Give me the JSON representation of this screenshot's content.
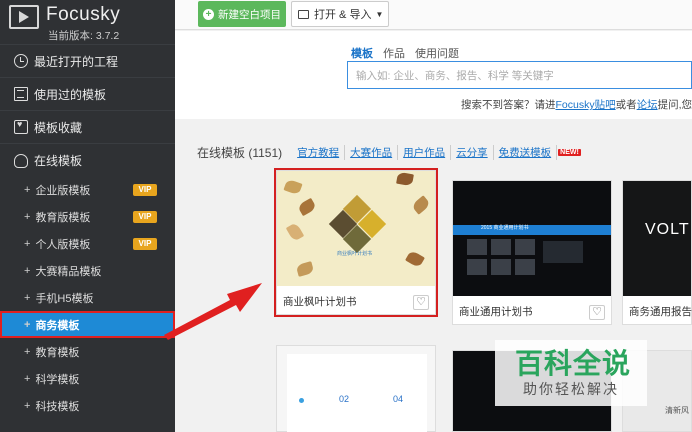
{
  "app": {
    "name": "Focusky",
    "version": "当前版本: 3.7.2"
  },
  "sidebar": {
    "sections": [
      {
        "label": "最近打开的工程",
        "icon": "clock-icon"
      },
      {
        "label": "使用过的模板",
        "icon": "list-icon"
      },
      {
        "label": "模板收藏",
        "icon": "heart-folder-icon"
      },
      {
        "label": "在线模板",
        "icon": "cloud-icon"
      }
    ],
    "items": [
      {
        "label": "企业版模板",
        "badge": "VIP"
      },
      {
        "label": "教育版模板",
        "badge": "VIP"
      },
      {
        "label": "个人版模板",
        "badge": "VIP"
      },
      {
        "label": "大赛精品模板"
      },
      {
        "label": "手机H5模板"
      },
      {
        "label": "商务模板",
        "active": true
      },
      {
        "label": "教育模板"
      },
      {
        "label": "科学模板"
      },
      {
        "label": "科技模板"
      }
    ]
  },
  "toolbar": {
    "new_label": "新建空白项目",
    "open_label": "打开 & 导入"
  },
  "search": {
    "tabs": [
      "模板",
      "作品",
      "使用问题"
    ],
    "placeholder": "输入如: 企业、商务、报告、科学 等关键字",
    "hint_prefix": "搜索不到答案？请进",
    "hint_link1": "Focusky贴吧",
    "hint_mid": "或者",
    "hint_link2": "论坛",
    "hint_suffix": "提问,您会"
  },
  "filter": {
    "count_label": "在线模板 (1151)",
    "links": [
      "官方教程",
      "大赛作品",
      "用户作品",
      "云分享",
      "免费送模板"
    ],
    "new_badge": "NEW!"
  },
  "cards": [
    {
      "caption": "商业枫叶计划书",
      "thumb_text": "商业枫叶计划书"
    },
    {
      "caption": "商业通用计划书",
      "thumb_text": "2015 商业通用计划书"
    },
    {
      "caption": "商务通用报告",
      "thumb_text": "VOLT"
    }
  ],
  "row2": {
    "labels": [
      "02",
      "04"
    ],
    "corner_text": "清新风"
  },
  "watermark": {
    "line1": "百科全说",
    "line2": "助你轻松解决"
  },
  "colors": {
    "sidebar_bg": "#2f3134",
    "active_blue": "#1e8ad6",
    "vip_orange": "#e8a51e",
    "highlight_red": "#d42020",
    "new_green": "#5cb85c"
  }
}
